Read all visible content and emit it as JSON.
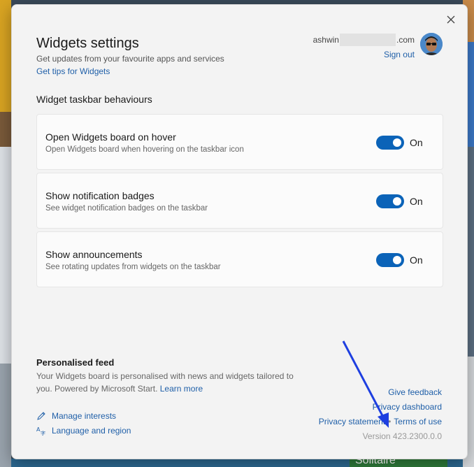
{
  "dialog": {
    "title": "Widgets settings",
    "subtitle": "Get updates from your favourite apps and services",
    "tips_link": "Get tips for Widgets"
  },
  "account": {
    "email_prefix": "ashwin",
    "email_suffix": ".com",
    "sign_out": "Sign out"
  },
  "section": {
    "heading": "Widget taskbar behaviours",
    "items": [
      {
        "label": "Open Widgets board on hover",
        "description": "Open Widgets board when hovering on the taskbar icon",
        "state": "On"
      },
      {
        "label": "Show notification badges",
        "description": "See widget notification badges on the taskbar",
        "state": "On"
      },
      {
        "label": "Show announcements",
        "description": "See rotating updates from widgets on the taskbar",
        "state": "On"
      }
    ]
  },
  "feed": {
    "heading": "Personalised feed",
    "description": "Your Widgets board is personalised with news and widgets tailored to you. Powered by Microsoft Start.",
    "learn_more": "Learn more",
    "manage_interests": "Manage interests",
    "language_region": "Language and region"
  },
  "links": {
    "give_feedback": "Give feedback",
    "privacy_dashboard": "Privacy dashboard",
    "privacy_statement": "Privacy statement",
    "terms_of_use": "Terms of use",
    "version": "Version 423.2300.0.0"
  },
  "background": {
    "tile_text": "Solitaire"
  },
  "colors": {
    "accent": "#0b63b8",
    "link": "#1f5fa8",
    "annotation_arrow": "#1e3fe0"
  }
}
